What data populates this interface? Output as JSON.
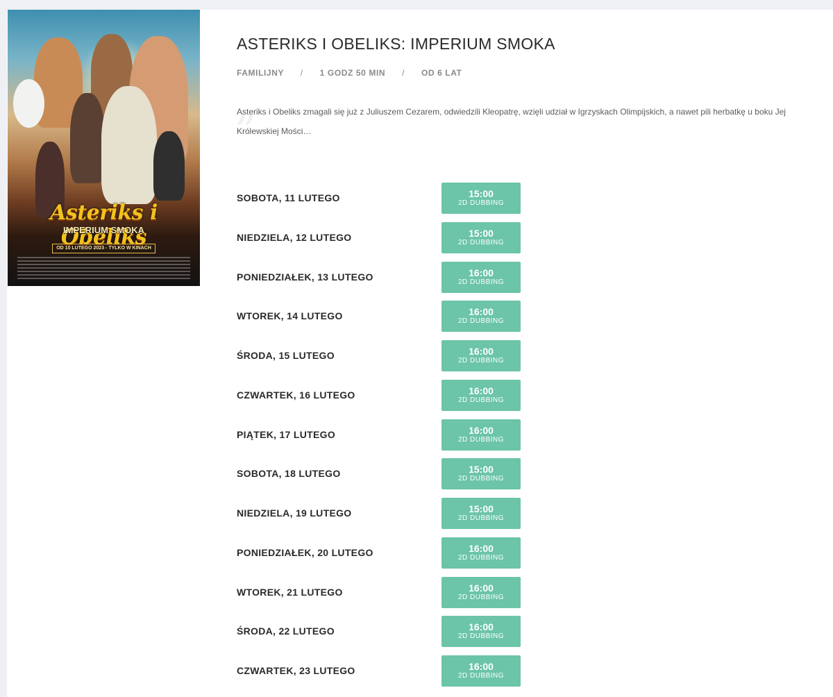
{
  "movie": {
    "title": "ASTERIKS I OBELIKS: IMPERIUM SMOKA",
    "genre": "FAMILIJNY",
    "duration": "1 GODZ 50 MIN",
    "age": "OD 6 LAT",
    "separator": "/",
    "quote_glyph": "„",
    "description": "Asteriks i Obeliks zmagali się już z Juliuszem Cezarem, odwiedzili Kleopatrę, wzięli udział w Igrzyskach Olimpijskich, a nawet pili herbatkę u boku Jej Królewskiej Mości…",
    "poster": {
      "logo_text": "Asteriks i Obeliks",
      "subtitle": "IMPERIUM SMOKA",
      "release_strip": "OD 10 LUTEGO 2023 - TYLKO W KINACH"
    }
  },
  "showtimes": [
    {
      "day": "SOBOTA, 11 LUTEGO",
      "time": "15:00",
      "format": "2D DUBBING"
    },
    {
      "day": "NIEDZIELA, 12 LUTEGO",
      "time": "15:00",
      "format": "2D DUBBING"
    },
    {
      "day": "PONIEDZIAŁEK, 13 LUTEGO",
      "time": "16:00",
      "format": "2D DUBBING"
    },
    {
      "day": "WTOREK, 14 LUTEGO",
      "time": "16:00",
      "format": "2D DUBBING"
    },
    {
      "day": "ŚRODA, 15 LUTEGO",
      "time": "16:00",
      "format": "2D DUBBING"
    },
    {
      "day": "CZWARTEK, 16 LUTEGO",
      "time": "16:00",
      "format": "2D DUBBING"
    },
    {
      "day": "PIĄTEK, 17 LUTEGO",
      "time": "16:00",
      "format": "2D DUBBING"
    },
    {
      "day": "SOBOTA, 18 LUTEGO",
      "time": "15:00",
      "format": "2D DUBBING"
    },
    {
      "day": "NIEDZIELA, 19 LUTEGO",
      "time": "15:00",
      "format": "2D DUBBING"
    },
    {
      "day": "PONIEDZIAŁEK, 20 LUTEGO",
      "time": "16:00",
      "format": "2D DUBBING"
    },
    {
      "day": "WTOREK, 21 LUTEGO",
      "time": "16:00",
      "format": "2D DUBBING"
    },
    {
      "day": "ŚRODA, 22 LUTEGO",
      "time": "16:00",
      "format": "2D DUBBING"
    },
    {
      "day": "CZWARTEK, 23 LUTEGO",
      "time": "16:00",
      "format": "2D DUBBING"
    }
  ],
  "colors": {
    "accent": "#6cc4a9",
    "page_background": "#eef0f4",
    "card_background": "#ffffff"
  }
}
